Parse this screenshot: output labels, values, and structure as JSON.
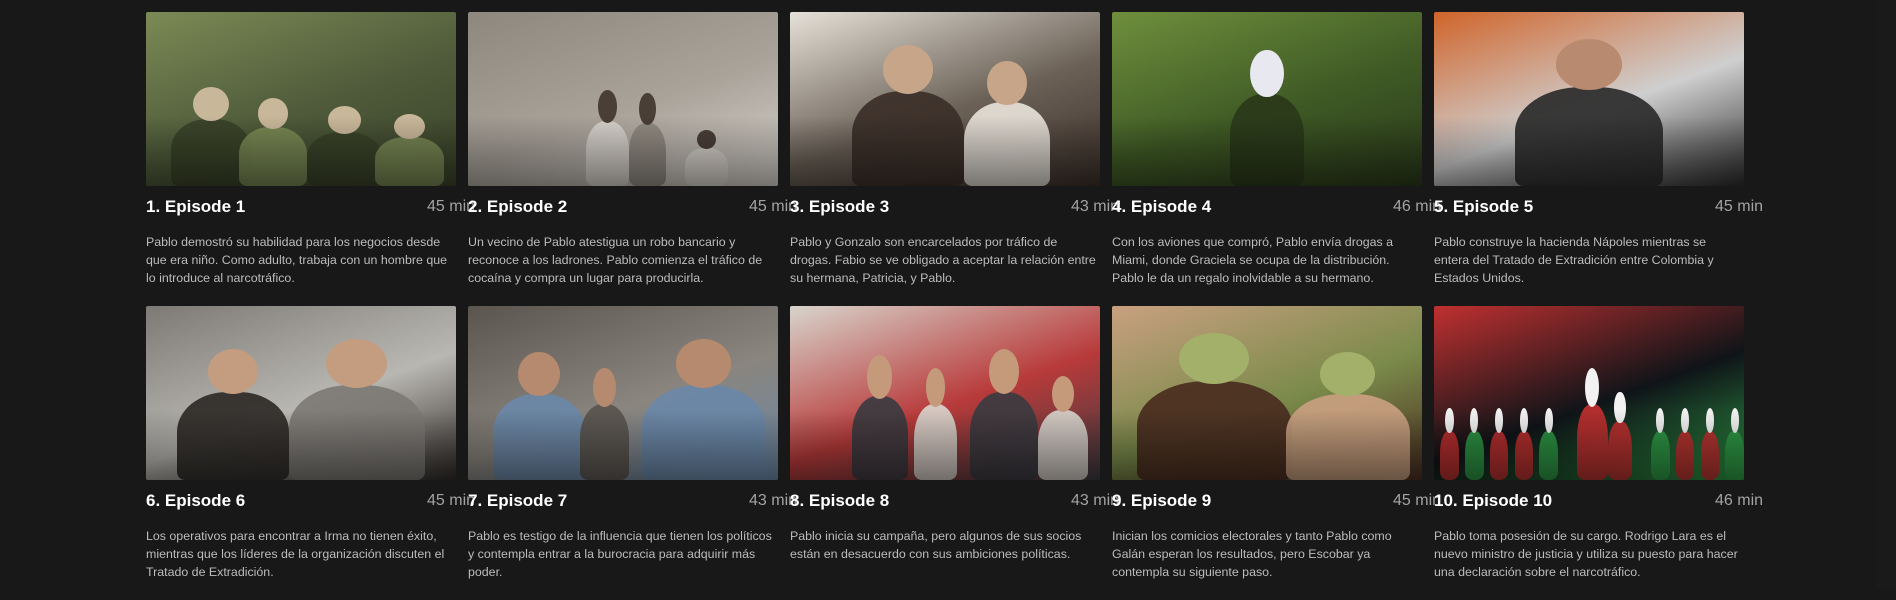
{
  "episodes": [
    {
      "title": "1. Episode 1",
      "duration": "45 min",
      "description": "Pablo demostró su habilidad para los negocios desde que era niño. Como adulto, trabaja con un hombre que lo introduce al narcotráfico.",
      "palette": [
        "#4e5a3a",
        "#7b8a55",
        "#3a4228",
        "#c9b79a"
      ]
    },
    {
      "title": "2. Episode 2",
      "duration": "45 min",
      "description": "Un vecino de Pablo atestigua un robo bancario y reconoce a los ladrones. Pablo comienza el tráfico de cocaína y compra un lugar para producirla.",
      "palette": [
        "#a9a39a",
        "#8d877e",
        "#d8d3cc",
        "#4a3f37"
      ]
    },
    {
      "title": "3. Episode 3",
      "duration": "43 min",
      "description": "Pablo y Gonzalo son encarcelados por tráfico de drogas. Fabio se ve obligado a aceptar la relación entre su hermana, Patricia, y Pablo.",
      "palette": [
        "#6b6157",
        "#e6e1d8",
        "#3b2f28",
        "#c6a589"
      ]
    },
    {
      "title": "4. Episode 4",
      "duration": "46 min",
      "description": "Con los aviones que compró, Pablo envía drogas a Miami, donde Graciela se ocupa de la distribución. Pablo le da un regalo inolvidable a su hermano.",
      "palette": [
        "#3f5a25",
        "#6f8f3c",
        "#2a3a1a",
        "#e8e8f0"
      ]
    },
    {
      "title": "5. Episode 5",
      "duration": "45 min",
      "description": "Pablo construye la hacienda Nápoles mientras se entera del Tratado de Extradición entre Colombia y Estados Unidos.",
      "palette": [
        "#cfcfcf",
        "#d0642a",
        "#2b2b2b",
        "#b88a70"
      ]
    },
    {
      "title": "6. Episode 6",
      "duration": "45 min",
      "description": "Los operativos para encontrar a Irma no tienen éxito, mientras que los líderes de la organización discuten el Tratado de Extradición.",
      "palette": [
        "#b9b7b2",
        "#7d7a75",
        "#2e2a27",
        "#c49c80"
      ]
    },
    {
      "title": "7. Episode 7",
      "duration": "43 min",
      "description": "Pablo es testigo de la influencia que tienen los políticos y contempla entrar a la burocracia para adquirir más poder.",
      "palette": [
        "#8a857e",
        "#5a554e",
        "#6a88a8",
        "#b58a6f"
      ]
    },
    {
      "title": "8. Episode 8",
      "duration": "43 min",
      "description": "Pablo inicia su campaña, pero algunos de sus socios están en desacuerdo con sus ambiciones políticas.",
      "palette": [
        "#b83a3a",
        "#d8d4cc",
        "#3b3b40",
        "#c49a7a"
      ]
    },
    {
      "title": "9. Episode 9",
      "duration": "45 min",
      "description": "Inician los comicios electorales y tanto Pablo como Galán esperan los resultados, pero Escobar ya contempla su siguiente paso.",
      "palette": [
        "#7a8a4a",
        "#c9a080",
        "#4a2c20",
        "#a3b06a"
      ]
    },
    {
      "title": "10. Episode 10",
      "duration": "46 min",
      "description": "Pablo toma posesión de su cargo. Rodrigo Lara es el nuevo ministro de justicia y utiliza su puesto para hacer una declaración sobre el narcotráfico.",
      "palette": [
        "#0f1418",
        "#c03030",
        "#2f9a45",
        "#f2f2f2"
      ]
    }
  ]
}
